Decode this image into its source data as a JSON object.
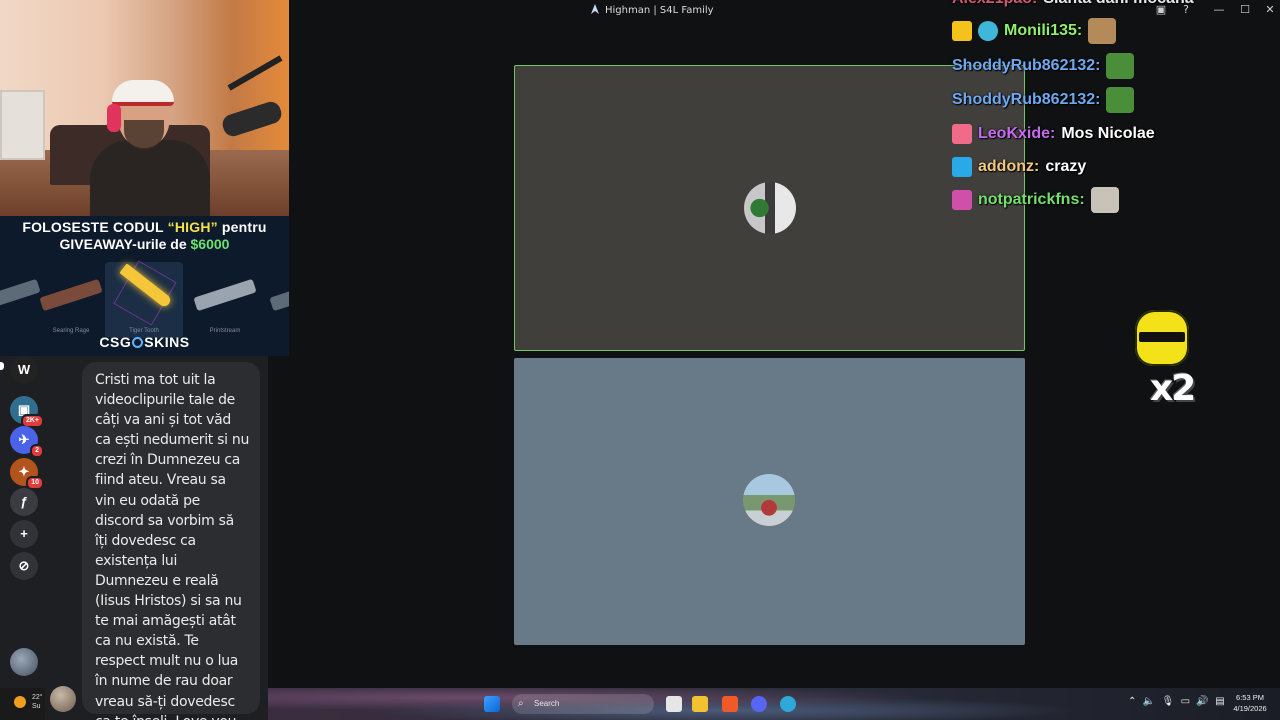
{
  "window": {
    "title": "Highman | S4L Family",
    "controls": [
      "▣",
      "?",
      "—",
      "☐",
      "✕"
    ]
  },
  "promo": {
    "line1_prefix": "FOLOSESTE CODUL ",
    "code": "“HIGH”",
    "line1_suffix": " pentru",
    "line2_prefix": "GIVEAWAY-urile de ",
    "amount": "$6000",
    "items": [
      {
        "name": "Searing Rage"
      },
      {
        "name": "Tiger Tooth"
      },
      {
        "name": "Printstream"
      }
    ],
    "brand_left": "CSG",
    "brand_right": "SKINS"
  },
  "rail": {
    "servers": [
      {
        "label": "W",
        "badge": ""
      },
      {
        "label": "▣",
        "badge": "2K+"
      },
      {
        "label": "✈",
        "badge": "2"
      },
      {
        "label": "✦",
        "badge": "10"
      },
      {
        "label": "ƒ",
        "badge": ""
      },
      {
        "label": "+",
        "badge": ""
      },
      {
        "label": "⊘",
        "badge": ""
      }
    ]
  },
  "message": {
    "text": "Cristi ma tot uit la videoclipurile tale de câți va ani și tot văd ca ești nedumerit si nu crezi în Dumnezeu ca fiind ateu. Vreau sa vin eu odată pe discord sa vorbim să îți dovedesc ca existența lui Dumnezeu e reală (Iisus Hristos) si sa nu te mai amăgești atât ca nu există. Te respect mult nu o lua în nume de rau doar vreau să-ți dovedesc ca te înșeli. Love you 🫶"
  },
  "chat": {
    "lines": [
      {
        "user": "Monili135:",
        "color": "#8ef06b",
        "msg": "",
        "badge_color": "#f4c21b",
        "emote": true
      },
      {
        "user": "ShoddyRub862132:",
        "color": "#6ea8f0",
        "msg": "",
        "badge_color": "",
        "emote": true
      },
      {
        "user": "ShoddyRub862132:",
        "color": "#6ea8f0",
        "msg": "",
        "badge_color": "",
        "emote": true
      },
      {
        "user": "LeoKxide:",
        "color": "#c76bf0",
        "msg": "Mos Nicolae",
        "badge_color": "#f06b8a",
        "emote": false
      },
      {
        "user": "addonz:",
        "color": "#f0c880",
        "msg": "crazy",
        "badge_color": "#29a9e8",
        "emote": false
      },
      {
        "user": "notpatrickfns:",
        "color": "#74e06b",
        "msg": "",
        "badge_color": "#d04fa8",
        "emote": true
      }
    ],
    "partial_top_user": "Alex21pao:",
    "partial_top_msg": "Sianta dani mocana"
  },
  "emote_multiplier": "x2",
  "taskbar": {
    "weather_temp": "22°",
    "weather_label": "Su",
    "search_placeholder": "Search",
    "time": "6:53 PM",
    "date": "4/19/2026"
  }
}
